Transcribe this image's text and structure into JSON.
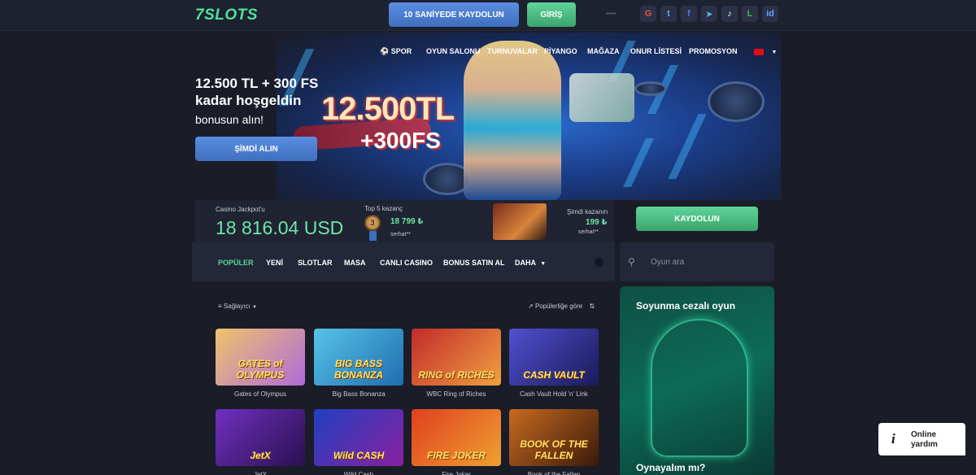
{
  "header": {
    "logo": "7SLOTS",
    "register_label": "10 SANİYEDE KAYDOLUN",
    "login_label": "GİRİŞ",
    "dots": "•••••",
    "social": [
      {
        "name": "google",
        "glyph": "G",
        "color": "#e5533d"
      },
      {
        "name": "twitter",
        "glyph": "t",
        "color": "#4ab3f4"
      },
      {
        "name": "facebook",
        "glyph": "f",
        "color": "#4a7ce0"
      },
      {
        "name": "telegram",
        "glyph": "➤",
        "color": "#5fb8e8"
      },
      {
        "name": "tiktok",
        "glyph": "♪",
        "color": "#ffffff"
      },
      {
        "name": "line",
        "glyph": "L",
        "color": "#3fbe57"
      },
      {
        "name": "yandex",
        "glyph": "id",
        "color": "#6aa0ff"
      }
    ]
  },
  "nav": {
    "items": [
      "SPOR",
      "OYUN SALONU",
      "TURNUVALAR",
      "PİYANGO",
      "MAĞAZA",
      "ONUR LİSTESİ",
      "PROMOSYON"
    ]
  },
  "hero": {
    "title": "12.500 TL + 300 FS kadar hoşgeldin",
    "subtitle": "bonusun alın!",
    "cta": "ŞİMDİ ALIN",
    "banner_amount": "12.500TL",
    "banner_fs": "+300FS"
  },
  "jackpot": {
    "label": "Casino Jackpot'u",
    "value": "18 816.04 USD",
    "top5_label": "Top 5 kazanç",
    "top5_rank": "3",
    "top5_amount": "18 799 ₺",
    "top5_user": "serhat**",
    "now_label": "Şimdi kazanın",
    "now_amount": "199 ₺",
    "now_user": "serhat**",
    "register_label": "KAYDOLUN"
  },
  "categories": {
    "tabs": [
      "POPÜLER",
      "YENİ",
      "SLOTLAR",
      "MASA",
      "CANLI CASINO",
      "BONUS SATIN AL",
      "DAHA"
    ],
    "active": 0,
    "search_placeholder": "Oyun ara"
  },
  "filters": {
    "provider": "Sağlayıcı",
    "sort": "Popülerliğe göre"
  },
  "games": [
    {
      "title": "GATES of OLYMPUS",
      "name": "Gates of Olympus",
      "colors": [
        "#f0c36b",
        "#b06ad9"
      ]
    },
    {
      "title": "BIG BASS BONANZA",
      "name": "Big Bass Bonanza",
      "colors": [
        "#57c4e8",
        "#1f6db0"
      ]
    },
    {
      "title": "RING of RICHES",
      "name": "WBC Ring of Riches",
      "colors": [
        "#c22a2a",
        "#f0a040"
      ]
    },
    {
      "title": "CASH VAULT",
      "name": "Cash Vault Hold 'n' Link",
      "colors": [
        "#5050d0",
        "#1a1a5a"
      ]
    },
    {
      "title": "JetX",
      "name": "JetX",
      "colors": [
        "#7030c0",
        "#2a1050"
      ]
    },
    {
      "title": "Wild CASH",
      "name": "Wild Cash",
      "colors": [
        "#2040c0",
        "#8a20a0"
      ]
    },
    {
      "title": "FIRE JOKER",
      "name": "Fire Joker",
      "colors": [
        "#e04020",
        "#f0a030"
      ]
    },
    {
      "title": "BOOK OF THE FALLEN",
      "name": "Book of the Fallen",
      "colors": [
        "#c86a20",
        "#3a1a0a"
      ]
    }
  ],
  "promo": {
    "title": "Soyunma cezalı oyun",
    "cta": "Oynayalım mı?"
  },
  "help": {
    "icon": "i",
    "label": "Online yardım"
  }
}
